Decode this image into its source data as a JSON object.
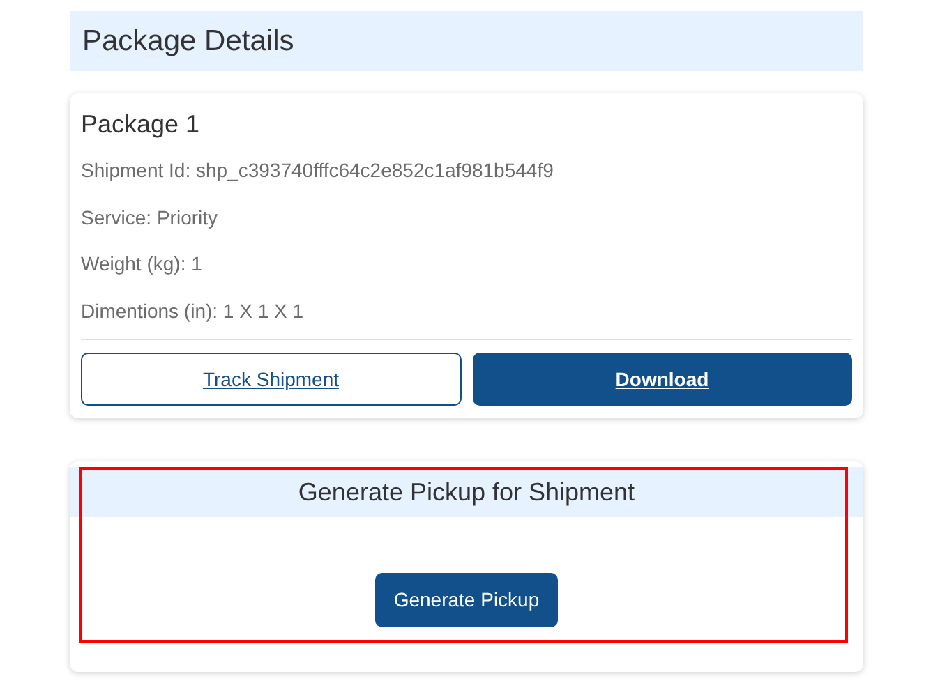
{
  "page_title": "Package Details",
  "packages": [
    {
      "title": "Package 1",
      "details": [
        "Shipment Id: shp_c393740fffc64c2e852c1af981b544f9",
        "Service: Priority",
        "Weight (kg): 1",
        "Dimentions (in): 1 X 1 X 1"
      ],
      "buttons": [
        {
          "label": "Track Shipment",
          "kind": "outline"
        },
        {
          "label": "Download",
          "kind": "solid"
        }
      ]
    }
  ],
  "pickup": {
    "title": "Generate Pickup for Shipment",
    "button": "Generate Pickup",
    "highlighted": true
  }
}
